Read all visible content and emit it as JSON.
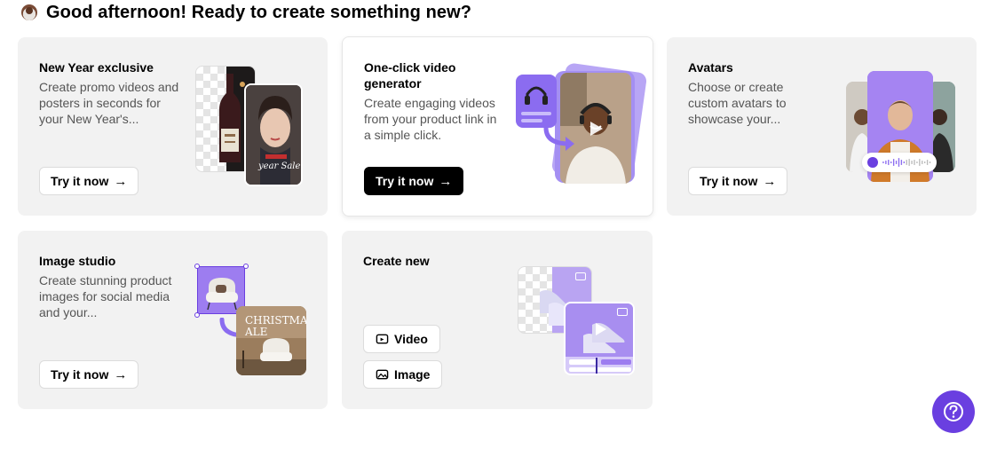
{
  "greeting": {
    "emoji": "coffee-cup",
    "text": "Good afternoon! Ready to create something new?"
  },
  "cards": [
    {
      "title": "New Year exclusive",
      "description": "Create promo videos and posters in seconds for your New Year's...",
      "button": "Try it now",
      "art_text": "year Sale"
    },
    {
      "title": "One-click video generator",
      "description": "Create engaging videos from your product link in a simple click.",
      "button": "Try it now"
    },
    {
      "title": "Avatars",
      "description": "Choose or create custom avatars to showcase your...",
      "button": "Try it now"
    },
    {
      "title": "Image studio",
      "description": "Create stunning product images for social media and your...",
      "button": "Try it now",
      "art_text": "CHRISTMAS ALE"
    },
    {
      "title": "Create new",
      "buttons": [
        "Video",
        "Image"
      ]
    }
  ],
  "colors": {
    "card_bg": "#f2f2f2",
    "accent_purple": "#8b6cf0",
    "help_button": "#6a3fe0"
  },
  "help_button": {
    "icon": "question-icon"
  }
}
